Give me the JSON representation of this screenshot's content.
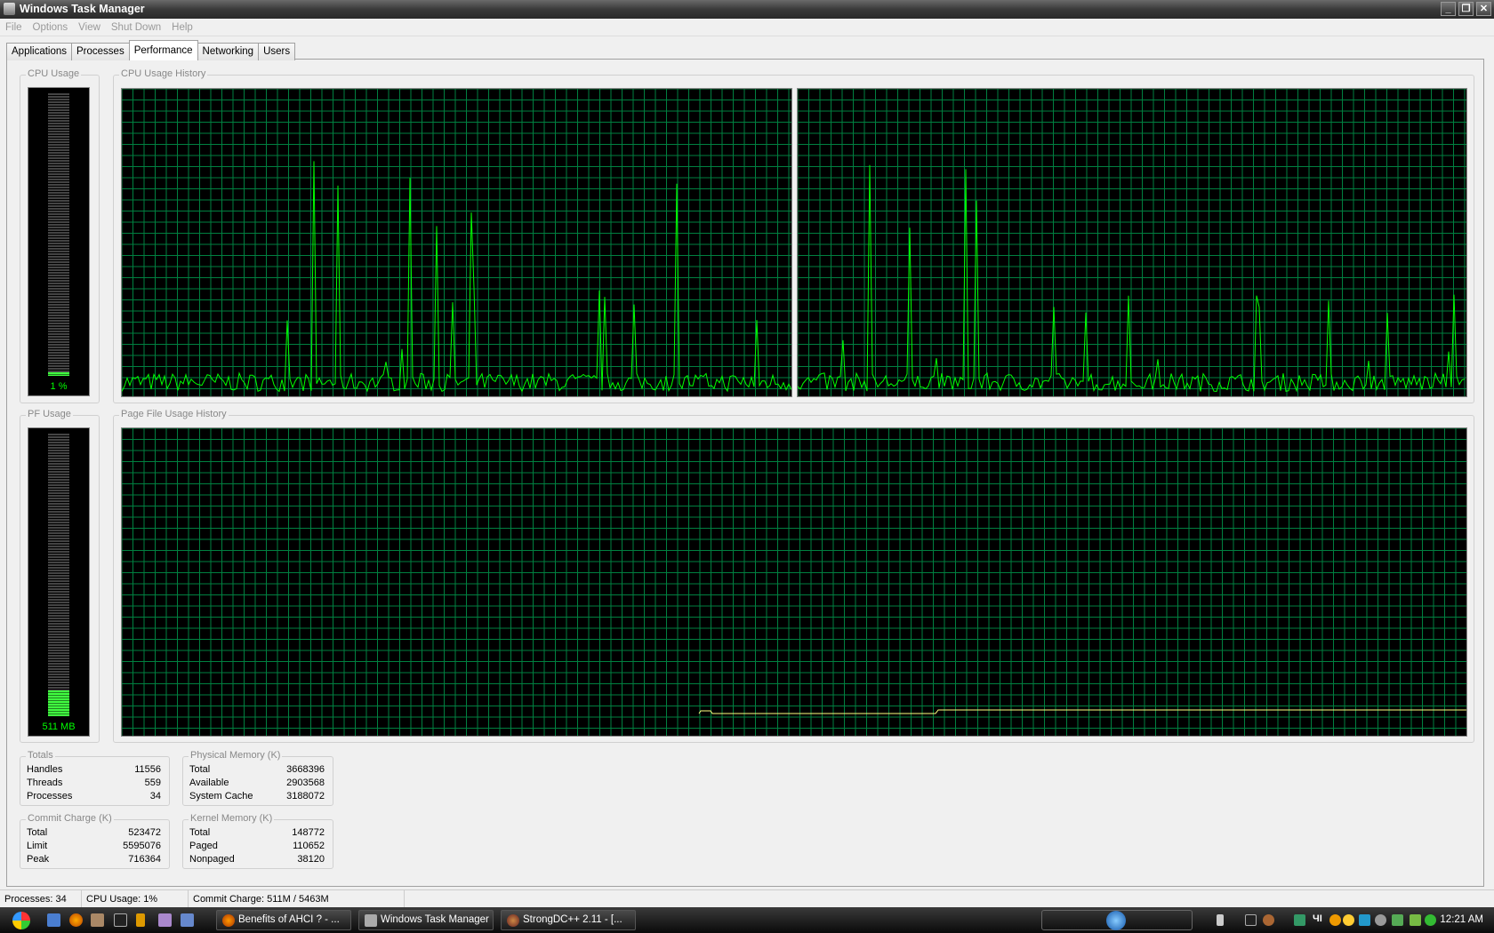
{
  "window": {
    "title": "Windows Task Manager",
    "minimize": "_",
    "maximize": "❐",
    "close": "✕"
  },
  "menu": [
    "File",
    "Options",
    "View",
    "Shut Down",
    "Help"
  ],
  "tabs": [
    "Applications",
    "Processes",
    "Performance",
    "Networking",
    "Users"
  ],
  "performance": {
    "cpu_usage": {
      "label": "CPU Usage",
      "value": "1 %",
      "percent": 1
    },
    "cpu_history": {
      "label": "CPU Usage History"
    },
    "pf_usage": {
      "label": "PF Usage",
      "value": "511 MB",
      "percent": 9
    },
    "pf_history": {
      "label": "Page File Usage History"
    },
    "totals": {
      "label": "Totals",
      "rows": [
        {
          "k": "Handles",
          "v": "11556"
        },
        {
          "k": "Threads",
          "v": "559"
        },
        {
          "k": "Processes",
          "v": "34"
        }
      ]
    },
    "physical": {
      "label": "Physical Memory (K)",
      "rows": [
        {
          "k": "Total",
          "v": "3668396"
        },
        {
          "k": "Available",
          "v": "2903568"
        },
        {
          "k": "System Cache",
          "v": "3188072"
        }
      ]
    },
    "commit": {
      "label": "Commit Charge (K)",
      "rows": [
        {
          "k": "Total",
          "v": "523472"
        },
        {
          "k": "Limit",
          "v": "5595076"
        },
        {
          "k": "Peak",
          "v": "716364"
        }
      ]
    },
    "kernel": {
      "label": "Kernel Memory (K)",
      "rows": [
        {
          "k": "Total",
          "v": "148772"
        },
        {
          "k": "Paged",
          "v": "110652"
        },
        {
          "k": "Nonpaged",
          "v": "38120"
        }
      ]
    }
  },
  "status": {
    "processes": "Processes: 34",
    "cpu": "CPU Usage: 1%",
    "commit": "Commit Charge: 511M / 5463M"
  },
  "taskbar": {
    "tasks": [
      "Benefits of AHCI ? - ...",
      "Windows Task Manager",
      "StrongDC++ 2.11 - [..."
    ],
    "clock": "12:21 AM",
    "tray_text": "ЧI"
  },
  "colors": {
    "grid": "#008040",
    "line": "#00ff00",
    "pf_line": "#ffff80"
  }
}
